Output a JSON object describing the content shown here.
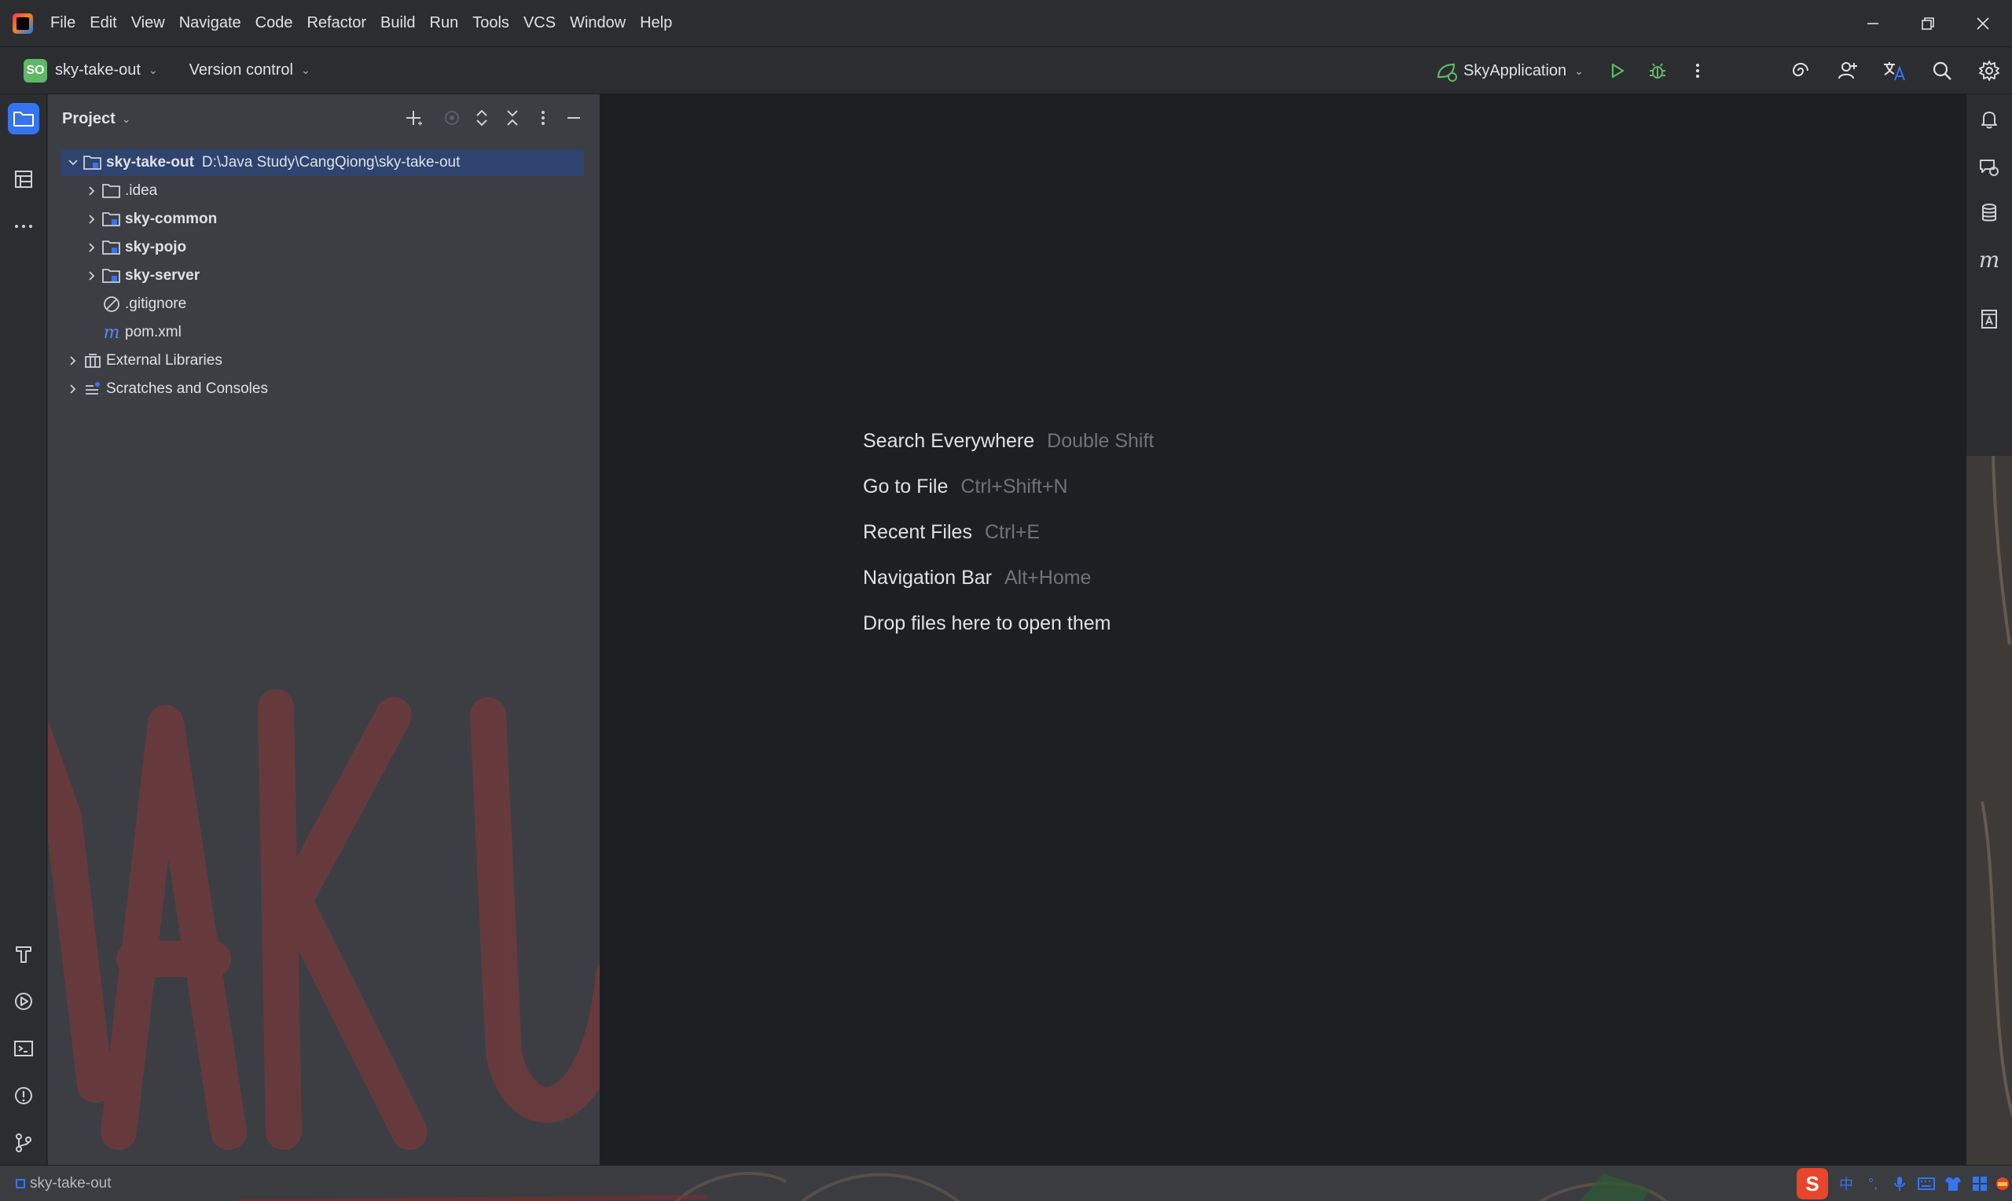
{
  "menu": {
    "items": [
      "File",
      "Edit",
      "View",
      "Navigate",
      "Code",
      "Refactor",
      "Build",
      "Run",
      "Tools",
      "VCS",
      "Window",
      "Help"
    ]
  },
  "toolbar": {
    "project_badge": "SO",
    "project_name": "sky-take-out",
    "vcs_label": "Version control",
    "run_config": "SkyApplication"
  },
  "project_panel": {
    "title": "Project",
    "tree": [
      {
        "label": "sky-take-out",
        "path": "D:\\Java Study\\CangQiong\\sky-take-out"
      },
      {
        "label": ".idea"
      },
      {
        "label": "sky-common"
      },
      {
        "label": "sky-pojo"
      },
      {
        "label": "sky-server"
      },
      {
        "label": ".gitignore"
      },
      {
        "label": "pom.xml"
      },
      {
        "label": "External Libraries"
      },
      {
        "label": "Scratches and Consoles"
      }
    ]
  },
  "editor": {
    "hints": [
      {
        "label": "Search Everywhere",
        "shortcut": "Double Shift"
      },
      {
        "label": "Go to File",
        "shortcut": "Ctrl+Shift+N"
      },
      {
        "label": "Recent Files",
        "shortcut": "Ctrl+E"
      },
      {
        "label": "Navigation Bar",
        "shortcut": "Alt+Home"
      },
      {
        "label": "Drop files here to open them",
        "shortcut": ""
      }
    ]
  },
  "status": {
    "breadcrumb": "sky-take-out",
    "ime_label": "中"
  },
  "colors": {
    "accent": "#3574f0",
    "run_green": "#5fb865",
    "selection": "#2e436e"
  }
}
